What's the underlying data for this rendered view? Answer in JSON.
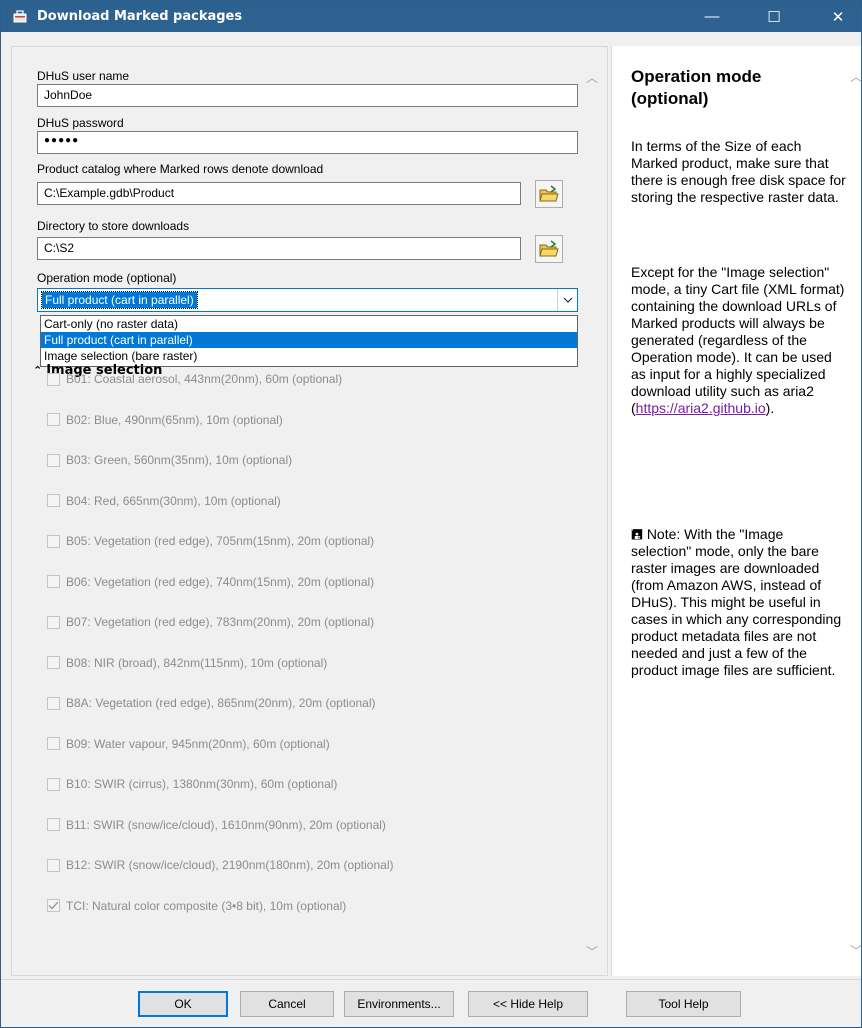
{
  "window": {
    "title": "Download Marked packages",
    "minimize_glyph": "—",
    "maximize_glyph": "☐",
    "close_glyph": "✕"
  },
  "form": {
    "user_label": "DHuS user name",
    "user_value": "JohnDoe",
    "password_label": "DHuS password",
    "password_value": "●●●●●",
    "catalog_label": "Product catalog where Marked rows denote download",
    "catalog_value": "C:\\Example.gdb\\Product",
    "directory_label": "Directory to store downloads",
    "directory_value": "C:\\S2",
    "mode_label": "Operation mode (optional)",
    "mode_value": "Full product (cart in parallel)",
    "mode_options": [
      "Cart-only (no raster data)",
      "Full product (cart in parallel)",
      "Image selection (bare raster)"
    ]
  },
  "image_selection": {
    "header": "Image selection",
    "bands": [
      {
        "label": "B01: Coastal aerosol, 443nm(20nm), 60m (optional)",
        "checked": false
      },
      {
        "label": "B02: Blue, 490nm(65nm), 10m (optional)",
        "checked": false
      },
      {
        "label": "B03: Green, 560nm(35nm), 10m (optional)",
        "checked": false
      },
      {
        "label": "B04: Red, 665nm(30nm), 10m (optional)",
        "checked": false
      },
      {
        "label": "B05: Vegetation (red edge), 705nm(15nm), 20m (optional)",
        "checked": false
      },
      {
        "label": "B06: Vegetation (red edge), 740nm(15nm), 20m (optional)",
        "checked": false
      },
      {
        "label": "B07: Vegetation (red edge), 783nm(20nm), 20m (optional)",
        "checked": false
      },
      {
        "label": "B08: NIR (broad), 842nm(115nm), 10m (optional)",
        "checked": false
      },
      {
        "label": "B8A: Vegetation (red edge), 865nm(20nm), 20m (optional)",
        "checked": false
      },
      {
        "label": "B09: Water vapour, 945nm(20nm), 60m (optional)",
        "checked": false
      },
      {
        "label": "B10: SWIR (cirrus), 1380nm(30nm), 60m (optional)",
        "checked": false
      },
      {
        "label": "B11: SWIR (snow/ice/cloud), 1610nm(90nm), 20m (optional)",
        "checked": false
      },
      {
        "label": "B12: SWIR (snow/ice/cloud), 2190nm(180nm), 20m (optional)",
        "checked": false
      },
      {
        "label": "TCI: Natural color composite (3•8 bit), 10m (optional)",
        "checked": true
      }
    ]
  },
  "help": {
    "title": "Operation mode (optional)",
    "para1": "In terms of the Size of each Marked product, make sure that there is enough free disk space for storing the respective raster data.",
    "para2_before": "Except for the \"Image selection\" mode, a tiny Cart file (XML format) containing the download URLs of Marked products will always be generated (regardless of the Operation mode). It can be used as input for a highly specialized download utility such as aria2 (",
    "para2_link": "https://aria2.github.io",
    "para2_after": ").",
    "note": "Note: With the \"Image selection\" mode, only the bare raster images are downloaded (from Amazon AWS, instead of DHuS). This might be useful in cases in which any corresponding product metadata files are not needed and just a few of the product image files are sufficient."
  },
  "buttons": {
    "ok": "OK",
    "cancel": "Cancel",
    "environments": "Environments...",
    "hide_help": "<< Hide Help",
    "tool_help": "Tool Help"
  },
  "colors": {
    "titlebar": "#2d6290",
    "selection": "#0078d7",
    "link": "#7a1ea1"
  }
}
